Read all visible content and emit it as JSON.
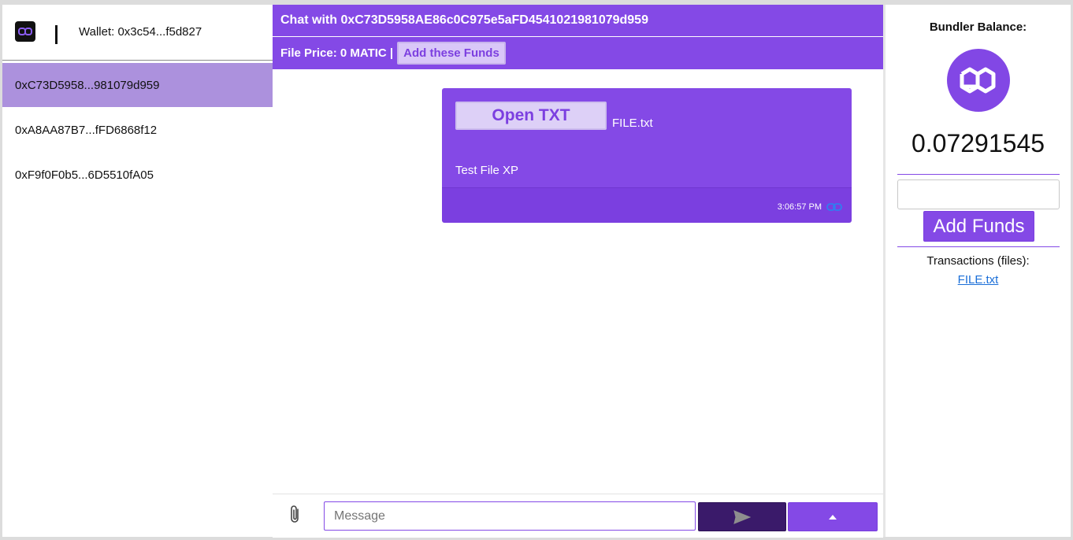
{
  "sidebar": {
    "wallet_label": "Wallet: 0x3c54...f5d827",
    "contacts": [
      {
        "address": "0xC73D5958...981079d959",
        "active": true
      },
      {
        "address": "0xA8AA87B7...fFD6868f12",
        "active": false
      },
      {
        "address": "0xF9f0F0b5...6D5510fA05",
        "active": false
      }
    ]
  },
  "chat": {
    "title": "Chat with 0xC73D5958AE86c0C975e5aFD4541021981079d959",
    "price_text": "File Price: 0 MATIC |",
    "add_funds_label": "Add these Funds",
    "message": {
      "open_button_label": "Open TXT",
      "file_name": "FILE.txt",
      "text": "Test File XP",
      "time": "3:06:57 PM"
    },
    "composer": {
      "placeholder": "Message"
    }
  },
  "right_panel": {
    "title": "Bundler Balance:",
    "balance": "0.07291545",
    "add_funds_label": "Add Funds",
    "transactions_title": "Transactions (files):",
    "transactions": [
      "FILE.txt"
    ]
  },
  "colors": {
    "accent": "#8449e6",
    "active_contact": "#ac91dd",
    "send_button": "#3a1a6a",
    "link": "#1a6ed8"
  },
  "icons": {
    "logo": "infinity-logo-icon",
    "attach": "paperclip-icon",
    "send": "send-icon",
    "more": "caret-up-icon",
    "message_link": "link-icon",
    "currency": "polygon-icon"
  }
}
